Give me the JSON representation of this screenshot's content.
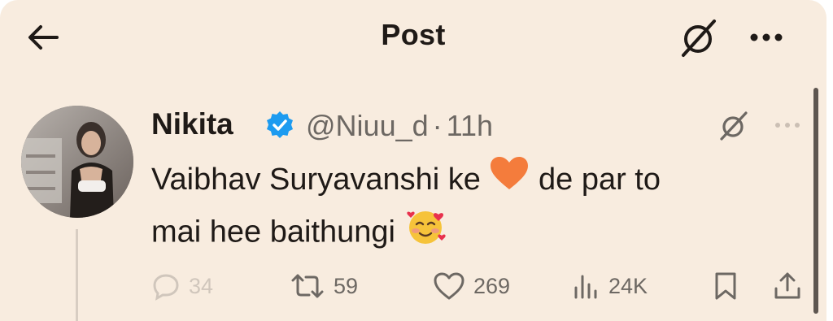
{
  "header": {
    "title": "Post",
    "back_icon": "arrow-left-icon",
    "grok_icon": "grok-icon",
    "more_icon": "more-horizontal-icon"
  },
  "tweet": {
    "author_name": "Nikita",
    "verified": true,
    "handle": "@Niuu_d",
    "separator": "·",
    "time": "11h",
    "text_part1": "Vaibhav Suryavanshi ke",
    "emoji1": "orange-heart",
    "text_part2": "de par to",
    "text_part3": "mai hee baithungi",
    "emoji2": "smiling-face-with-hearts"
  },
  "actions": {
    "replies": "34",
    "reposts": "59",
    "likes": "269",
    "views": "24K"
  },
  "colors": {
    "background": "#f8ecdf",
    "text": "#1f1a17",
    "secondary": "#6d6863",
    "verified": "#1d9bf0",
    "heart_emoji": "#f47c3c"
  }
}
